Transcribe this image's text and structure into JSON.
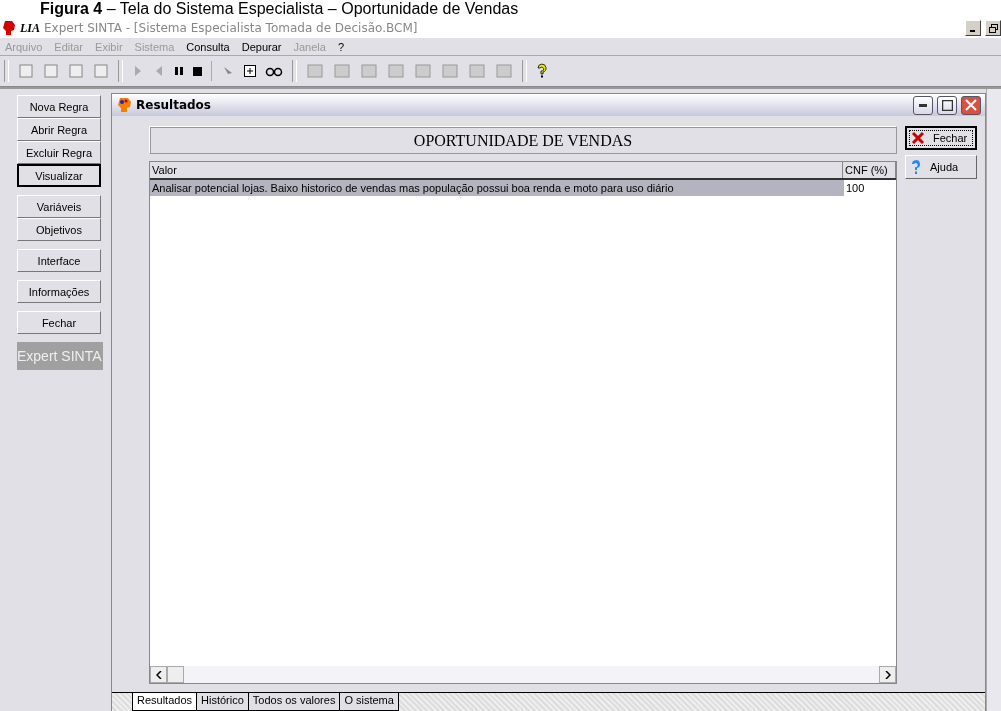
{
  "caption": "**Figura 4** – Tela do Sistema Especialista – Oportunidade de Vendas",
  "window": {
    "brand": "LIA",
    "title": "Expert SINTA - [Sistema Especialista Tomada de Decisão.BCM]"
  },
  "menu": [
    {
      "label": "Arquivo",
      "disabled": true
    },
    {
      "label": "Editar",
      "disabled": true
    },
    {
      "label": "Exibir",
      "disabled": true
    },
    {
      "label": "Sistema",
      "disabled": true
    },
    {
      "label": "Consulta",
      "disabled": false
    },
    {
      "label": "Depurar",
      "disabled": false
    },
    {
      "label": "Janela",
      "disabled": true
    },
    {
      "label": "?",
      "disabled": false
    }
  ],
  "sidebar": {
    "groups": [
      [
        {
          "label": "Nova Regra",
          "selected": false
        },
        {
          "label": "Abrir Regra",
          "selected": false
        },
        {
          "label": "Excluir Regra",
          "selected": false
        },
        {
          "label": "Visualizar",
          "selected": true
        }
      ],
      [
        {
          "label": "Variáveis",
          "selected": false
        },
        {
          "label": "Objetivos",
          "selected": false
        }
      ],
      [
        {
          "label": "Interface",
          "selected": false
        }
      ],
      [
        {
          "label": "Informações",
          "selected": false
        }
      ],
      [
        {
          "label": "Fechar",
          "selected": false
        }
      ]
    ],
    "logo": "Expert SINTA"
  },
  "child_window": {
    "title": "Resultados",
    "heading": "OPORTUNIDADE DE VENDAS",
    "buttons": [
      {
        "label": "Fechar",
        "kind": "close"
      },
      {
        "label": "Ajuda",
        "kind": "help"
      }
    ],
    "table": {
      "columns": [
        "Valor",
        "CNF (%)"
      ],
      "rows": [
        {
          "cells": [
            "Analisar potencial lojas. Baixo historico de vendas mas população possui boa renda e moto para uso diário",
            "100"
          ],
          "selected": true
        }
      ]
    },
    "tabs": [
      {
        "label": "Resultados",
        "selected": true
      },
      {
        "label": "Histórico",
        "selected": false
      },
      {
        "label": "Todos os valores",
        "selected": false
      },
      {
        "label": "O sistema",
        "selected": false
      }
    ]
  }
}
